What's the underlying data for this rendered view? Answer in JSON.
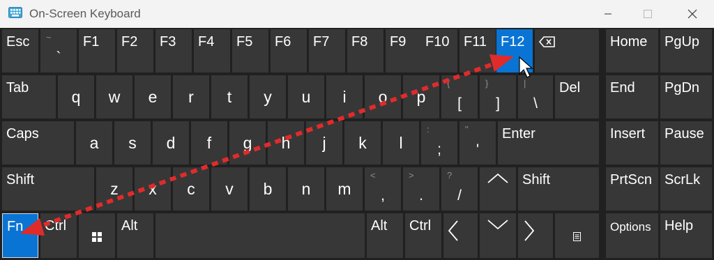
{
  "window": {
    "title": "On-Screen Keyboard",
    "app_icon": "keyboard-icon",
    "controls": [
      "minimize-icon",
      "maximize-icon",
      "close-icon"
    ]
  },
  "colors": {
    "window_bg": "#f3f3f3",
    "keyboard_bg": "#202020",
    "key_bg": "#373737",
    "key_active": "#0a74d4",
    "annotation_arrow": "#e02b2b"
  },
  "keys": {
    "esc": "Esc",
    "f1": "F1",
    "f2": "F2",
    "f3": "F3",
    "f4": "F4",
    "f5": "F5",
    "f6": "F6",
    "f7": "F7",
    "f8": "F8",
    "f9": "F9",
    "f10": "F10",
    "f11": "F11",
    "f12": "F12",
    "tilde": {
      "shift": "~",
      "main": "`"
    },
    "tab": "Tab",
    "q": "q",
    "w": "w",
    "e": "e",
    "r": "r",
    "t": "t",
    "y": "y",
    "u": "u",
    "i": "i",
    "o": "o",
    "p": "p",
    "lbracket": {
      "shift": "{",
      "main": "["
    },
    "rbracket": {
      "shift": "}",
      "main": "]"
    },
    "backslash": {
      "shift": "|",
      "main": "\\"
    },
    "del": "Del",
    "caps": "Caps",
    "a": "a",
    "s": "s",
    "d": "d",
    "f": "f",
    "g": "g",
    "h": "h",
    "j": "j",
    "k": "k",
    "l": "l",
    "semicolon": {
      "shift": ":",
      "main": ";"
    },
    "quote": {
      "shift": "\"",
      "main": "'"
    },
    "enter": "Enter",
    "shift_left": "Shift",
    "z": "z",
    "x": "x",
    "c": "c",
    "v": "v",
    "b": "b",
    "n": "n",
    "m": "m",
    "comma": {
      "shift": "<",
      "main": ","
    },
    "period": {
      "shift": ">",
      "main": "."
    },
    "slash": {
      "shift": "?",
      "main": "/"
    },
    "shift_right": "Shift",
    "fn": "Fn",
    "ctrl_left": "Ctrl",
    "alt_left": "Alt",
    "alt_right": "Alt",
    "ctrl_right": "Ctrl",
    "home": "Home",
    "pgup": "PgUp",
    "end": "End",
    "pgdn": "PgDn",
    "insert": "Insert",
    "pause": "Pause",
    "prtscn": "PrtScn",
    "scrlk": "ScrLk",
    "options": "Options",
    "help": "Help"
  },
  "active_keys": [
    "Fn",
    "F12"
  ],
  "annotation": {
    "type": "double-headed-dotted-arrow",
    "from_key": "Fn",
    "to_key": "F12"
  }
}
